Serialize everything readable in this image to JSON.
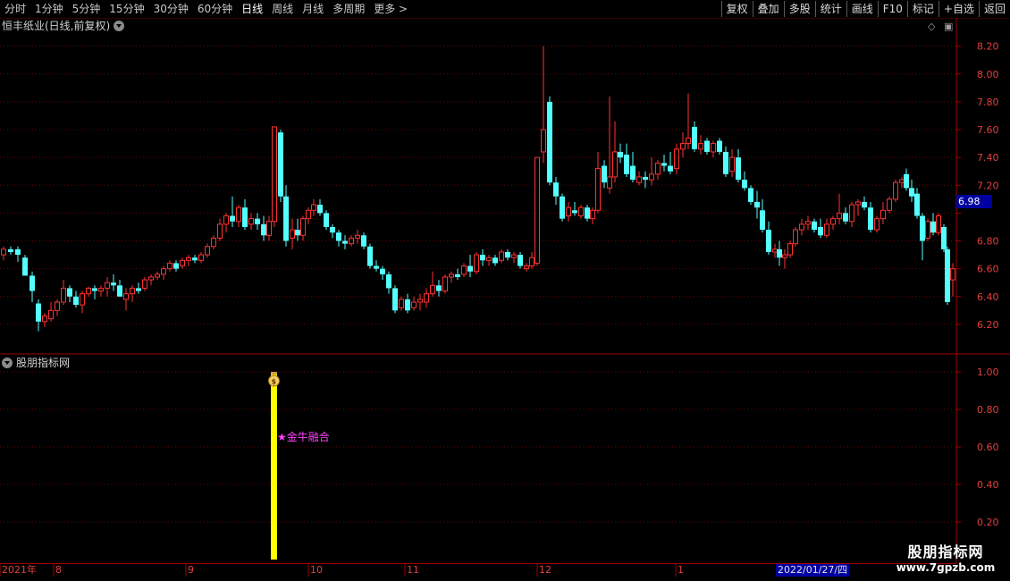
{
  "toolbar": {
    "periods": [
      "分时",
      "1分钟",
      "5分钟",
      "15分钟",
      "30分钟",
      "60分钟",
      "日线",
      "周线",
      "月线",
      "多周期",
      "更多 >"
    ],
    "active_period": "日线",
    "buttons": [
      "复权",
      "叠加",
      "多股",
      "统计",
      "画线",
      "F10",
      "标记",
      "+自选",
      "返回"
    ]
  },
  "main_chart": {
    "title": "恒丰纸业(日线,前复权)",
    "current_price": "6.98",
    "y_ticks": [
      "8.20",
      "8.00",
      "7.80",
      "7.60",
      "7.40",
      "7.20",
      "6.80",
      "6.60",
      "6.40",
      "6.20"
    ],
    "up_color": "#ff3232",
    "down_color": "#54ffff"
  },
  "sub_chart": {
    "title": "股朋指标网",
    "y_ticks": [
      "1.00",
      "0.80",
      "0.60",
      "0.40",
      "0.20"
    ],
    "signal_label": "★金牛融合",
    "signal_color": "#ffff00",
    "signal_icon": "money-bag-icon"
  },
  "date_axis": {
    "labels": [
      "2021年",
      "8",
      "9",
      "10",
      "11",
      "12",
      "1"
    ],
    "selected_date": "2022/01/27/四"
  },
  "watermark": {
    "line1": "股朋指标网",
    "line2": "www.7gpzb.com"
  }
}
